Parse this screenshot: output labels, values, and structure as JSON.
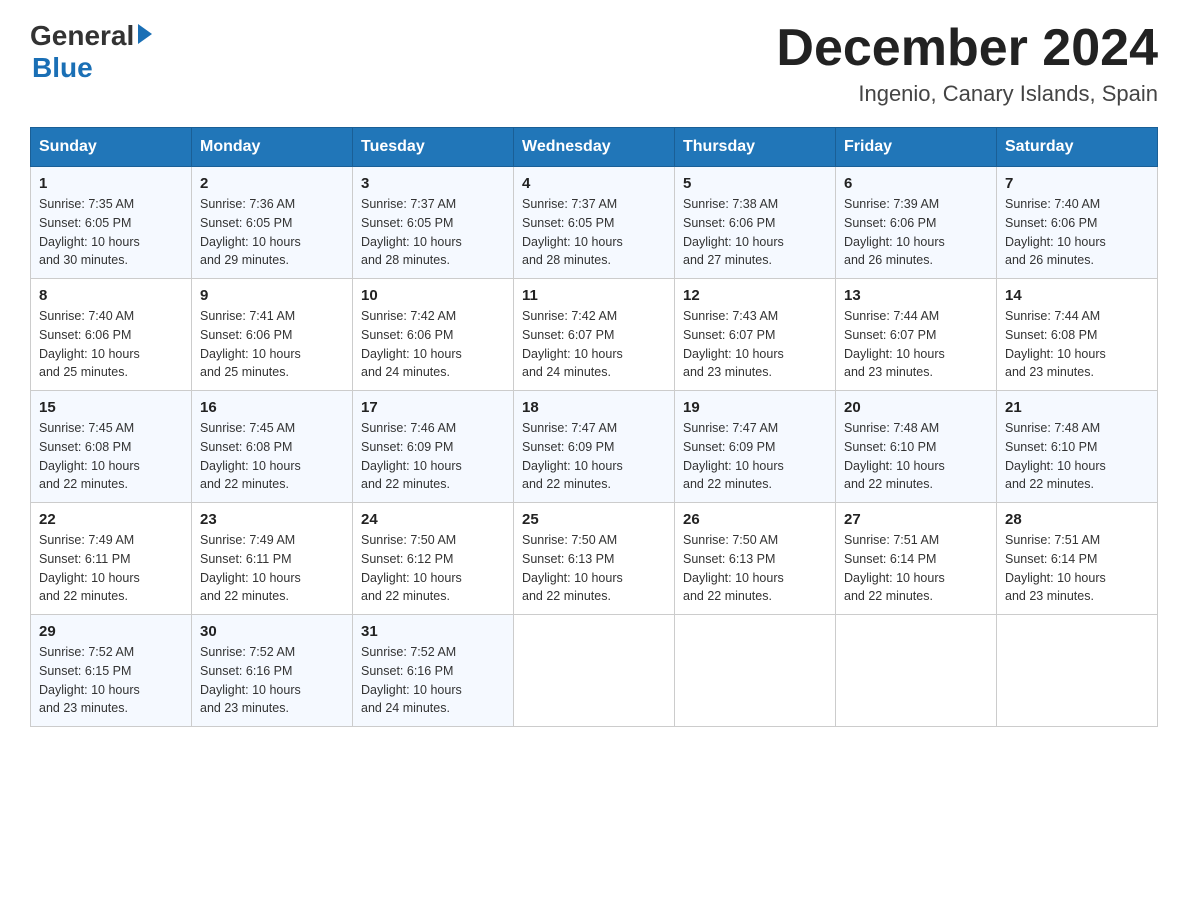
{
  "logo": {
    "text_general": "General",
    "text_blue": "Blue"
  },
  "title": {
    "month_year": "December 2024",
    "location": "Ingenio, Canary Islands, Spain"
  },
  "weekdays": [
    "Sunday",
    "Monday",
    "Tuesday",
    "Wednesday",
    "Thursday",
    "Friday",
    "Saturday"
  ],
  "weeks": [
    [
      {
        "day": "1",
        "sunrise": "7:35 AM",
        "sunset": "6:05 PM",
        "daylight": "10 hours and 30 minutes."
      },
      {
        "day": "2",
        "sunrise": "7:36 AM",
        "sunset": "6:05 PM",
        "daylight": "10 hours and 29 minutes."
      },
      {
        "day": "3",
        "sunrise": "7:37 AM",
        "sunset": "6:05 PM",
        "daylight": "10 hours and 28 minutes."
      },
      {
        "day": "4",
        "sunrise": "7:37 AM",
        "sunset": "6:05 PM",
        "daylight": "10 hours and 28 minutes."
      },
      {
        "day": "5",
        "sunrise": "7:38 AM",
        "sunset": "6:06 PM",
        "daylight": "10 hours and 27 minutes."
      },
      {
        "day": "6",
        "sunrise": "7:39 AM",
        "sunset": "6:06 PM",
        "daylight": "10 hours and 26 minutes."
      },
      {
        "day": "7",
        "sunrise": "7:40 AM",
        "sunset": "6:06 PM",
        "daylight": "10 hours and 26 minutes."
      }
    ],
    [
      {
        "day": "8",
        "sunrise": "7:40 AM",
        "sunset": "6:06 PM",
        "daylight": "10 hours and 25 minutes."
      },
      {
        "day": "9",
        "sunrise": "7:41 AM",
        "sunset": "6:06 PM",
        "daylight": "10 hours and 25 minutes."
      },
      {
        "day": "10",
        "sunrise": "7:42 AM",
        "sunset": "6:06 PM",
        "daylight": "10 hours and 24 minutes."
      },
      {
        "day": "11",
        "sunrise": "7:42 AM",
        "sunset": "6:07 PM",
        "daylight": "10 hours and 24 minutes."
      },
      {
        "day": "12",
        "sunrise": "7:43 AM",
        "sunset": "6:07 PM",
        "daylight": "10 hours and 23 minutes."
      },
      {
        "day": "13",
        "sunrise": "7:44 AM",
        "sunset": "6:07 PM",
        "daylight": "10 hours and 23 minutes."
      },
      {
        "day": "14",
        "sunrise": "7:44 AM",
        "sunset": "6:08 PM",
        "daylight": "10 hours and 23 minutes."
      }
    ],
    [
      {
        "day": "15",
        "sunrise": "7:45 AM",
        "sunset": "6:08 PM",
        "daylight": "10 hours and 22 minutes."
      },
      {
        "day": "16",
        "sunrise": "7:45 AM",
        "sunset": "6:08 PM",
        "daylight": "10 hours and 22 minutes."
      },
      {
        "day": "17",
        "sunrise": "7:46 AM",
        "sunset": "6:09 PM",
        "daylight": "10 hours and 22 minutes."
      },
      {
        "day": "18",
        "sunrise": "7:47 AM",
        "sunset": "6:09 PM",
        "daylight": "10 hours and 22 minutes."
      },
      {
        "day": "19",
        "sunrise": "7:47 AM",
        "sunset": "6:09 PM",
        "daylight": "10 hours and 22 minutes."
      },
      {
        "day": "20",
        "sunrise": "7:48 AM",
        "sunset": "6:10 PM",
        "daylight": "10 hours and 22 minutes."
      },
      {
        "day": "21",
        "sunrise": "7:48 AM",
        "sunset": "6:10 PM",
        "daylight": "10 hours and 22 minutes."
      }
    ],
    [
      {
        "day": "22",
        "sunrise": "7:49 AM",
        "sunset": "6:11 PM",
        "daylight": "10 hours and 22 minutes."
      },
      {
        "day": "23",
        "sunrise": "7:49 AM",
        "sunset": "6:11 PM",
        "daylight": "10 hours and 22 minutes."
      },
      {
        "day": "24",
        "sunrise": "7:50 AM",
        "sunset": "6:12 PM",
        "daylight": "10 hours and 22 minutes."
      },
      {
        "day": "25",
        "sunrise": "7:50 AM",
        "sunset": "6:13 PM",
        "daylight": "10 hours and 22 minutes."
      },
      {
        "day": "26",
        "sunrise": "7:50 AM",
        "sunset": "6:13 PM",
        "daylight": "10 hours and 22 minutes."
      },
      {
        "day": "27",
        "sunrise": "7:51 AM",
        "sunset": "6:14 PM",
        "daylight": "10 hours and 22 minutes."
      },
      {
        "day": "28",
        "sunrise": "7:51 AM",
        "sunset": "6:14 PM",
        "daylight": "10 hours and 23 minutes."
      }
    ],
    [
      {
        "day": "29",
        "sunrise": "7:52 AM",
        "sunset": "6:15 PM",
        "daylight": "10 hours and 23 minutes."
      },
      {
        "day": "30",
        "sunrise": "7:52 AM",
        "sunset": "6:16 PM",
        "daylight": "10 hours and 23 minutes."
      },
      {
        "day": "31",
        "sunrise": "7:52 AM",
        "sunset": "6:16 PM",
        "daylight": "10 hours and 24 minutes."
      },
      null,
      null,
      null,
      null
    ]
  ],
  "labels": {
    "sunrise": "Sunrise:",
    "sunset": "Sunset:",
    "daylight": "Daylight:"
  }
}
